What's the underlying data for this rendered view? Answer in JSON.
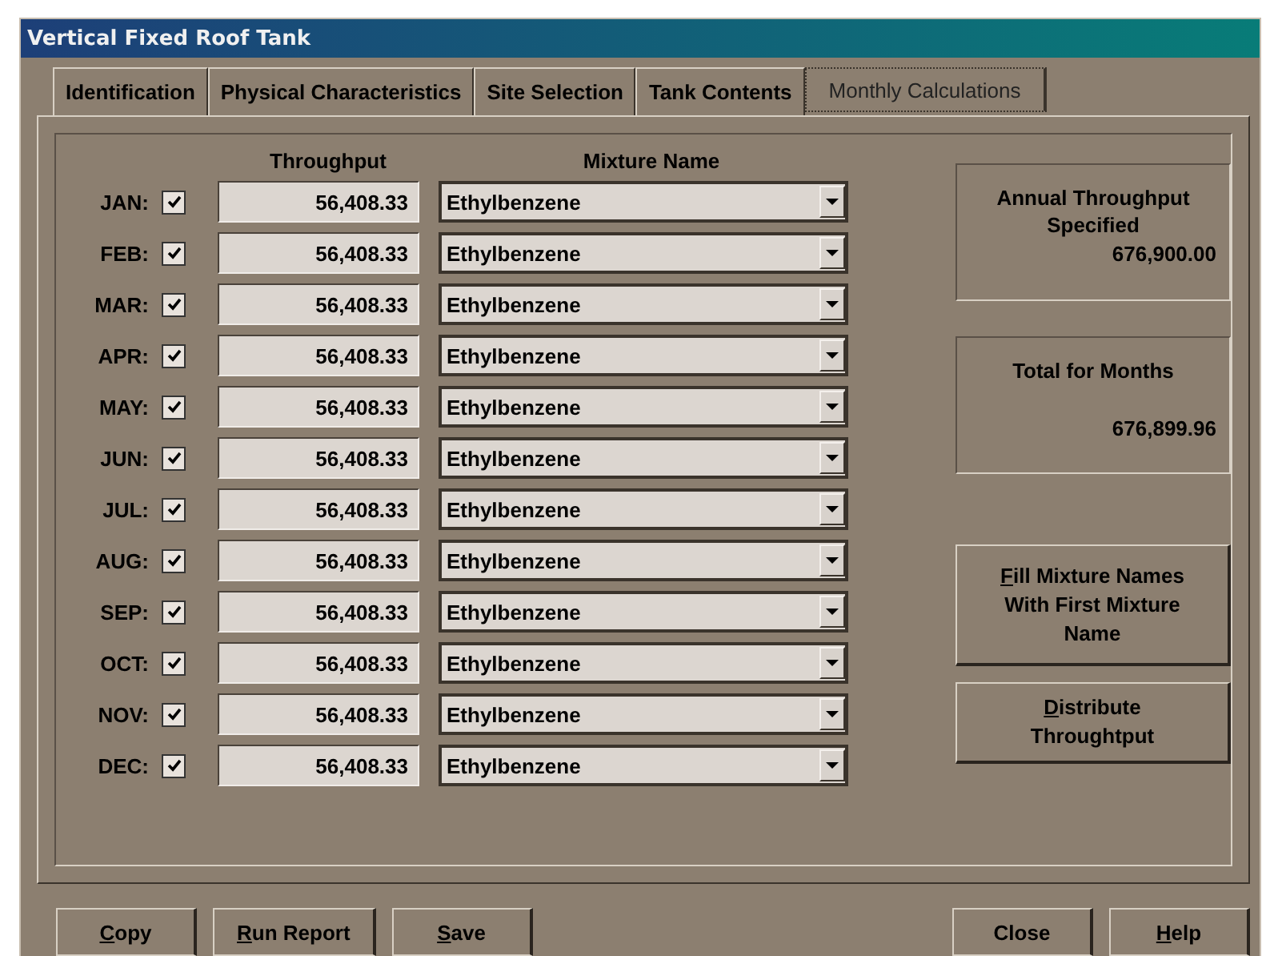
{
  "window": {
    "title": "Vertical Fixed Roof Tank"
  },
  "tabs": [
    {
      "label": "Identification",
      "selected": false
    },
    {
      "label": "Physical Characteristics",
      "selected": false
    },
    {
      "label": "Site Selection",
      "selected": false
    },
    {
      "label": "Tank Contents",
      "selected": false
    },
    {
      "label": "Monthly Calculations",
      "selected": true
    }
  ],
  "columns": {
    "throughput": "Throughput",
    "mixture": "Mixture Name"
  },
  "months": [
    {
      "label": "JAN:",
      "checked": true,
      "throughput": "56,408.33",
      "mixture": "Ethylbenzene"
    },
    {
      "label": "FEB:",
      "checked": true,
      "throughput": "56,408.33",
      "mixture": "Ethylbenzene"
    },
    {
      "label": "MAR:",
      "checked": true,
      "throughput": "56,408.33",
      "mixture": "Ethylbenzene"
    },
    {
      "label": "APR:",
      "checked": true,
      "throughput": "56,408.33",
      "mixture": "Ethylbenzene"
    },
    {
      "label": "MAY:",
      "checked": true,
      "throughput": "56,408.33",
      "mixture": "Ethylbenzene"
    },
    {
      "label": "JUN:",
      "checked": true,
      "throughput": "56,408.33",
      "mixture": "Ethylbenzene"
    },
    {
      "label": "JUL:",
      "checked": true,
      "throughput": "56,408.33",
      "mixture": "Ethylbenzene"
    },
    {
      "label": "AUG:",
      "checked": true,
      "throughput": "56,408.33",
      "mixture": "Ethylbenzene"
    },
    {
      "label": "SEP:",
      "checked": true,
      "throughput": "56,408.33",
      "mixture": "Ethylbenzene"
    },
    {
      "label": "OCT:",
      "checked": true,
      "throughput": "56,408.33",
      "mixture": "Ethylbenzene"
    },
    {
      "label": "NOV:",
      "checked": true,
      "throughput": "56,408.33",
      "mixture": "Ethylbenzene"
    },
    {
      "label": "DEC:",
      "checked": true,
      "throughput": "56,408.33",
      "mixture": "Ethylbenzene"
    }
  ],
  "annual": {
    "title": "Annual Throughput Specified",
    "value": "676,900.00"
  },
  "total": {
    "title": "Total for Months",
    "value": "676,899.96"
  },
  "side_buttons": [
    {
      "mnemonic": "F",
      "rest": "ill Mixture Names With First Mixture Name"
    },
    {
      "mnemonic": "D",
      "rest": "istribute Throughtput"
    }
  ],
  "bottom_left_buttons": [
    {
      "mnemonic": "C",
      "rest": "opy"
    },
    {
      "mnemonic": "R",
      "rest": "un Report"
    },
    {
      "mnemonic": "S",
      "rest": "ave"
    }
  ],
  "bottom_right_buttons": [
    {
      "rest": "Close"
    },
    {
      "mnemonic": "H",
      "rest": "elp"
    }
  ]
}
